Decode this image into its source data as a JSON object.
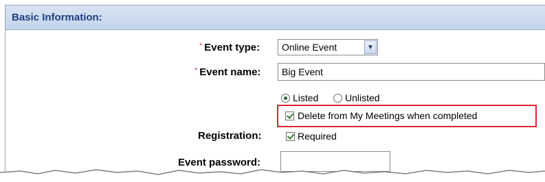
{
  "section": {
    "title": "Basic Information:"
  },
  "required_marker": "*",
  "event_type": {
    "label": "Event type:",
    "value": "Online Event"
  },
  "event_name": {
    "label": "Event name:",
    "value": "Big Event"
  },
  "listing": {
    "options": [
      {
        "label": "Listed",
        "selected": true
      },
      {
        "label": "Unlisted",
        "selected": false
      }
    ]
  },
  "delete_option": {
    "label": "Delete from My Meetings when completed",
    "checked": true
  },
  "registration": {
    "label": "Registration:",
    "option_label": "Required",
    "checked": true
  },
  "event_password": {
    "label": "Event password:",
    "value": ""
  },
  "colors": {
    "header_bg": "#c3d4ec",
    "header_text": "#1f3f80",
    "highlight": "#d9232e",
    "required": "#d04a4a"
  }
}
